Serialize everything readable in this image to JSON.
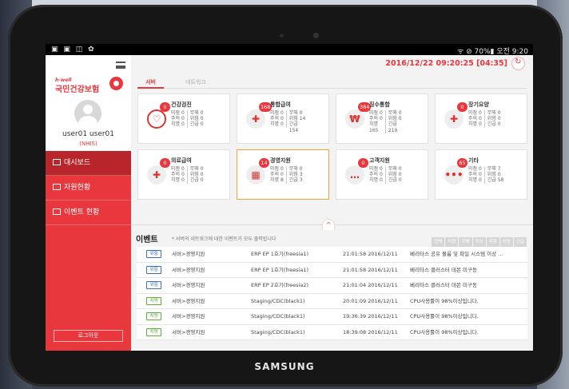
{
  "device": {
    "brand": "SAMSUNG"
  },
  "statusbar": {
    "left": "▣ ▣ ◫ ✿",
    "right": "ᯤ ⊘ 70%▮ 오전 9:20"
  },
  "sidebar": {
    "logo_small": "h-well",
    "logo_main": "국민건강보험",
    "username": "user01 user01",
    "org": "(NHIS)",
    "items": [
      {
        "label": "대시보드"
      },
      {
        "label": "자원현황"
      },
      {
        "label": "이벤트 현황"
      }
    ],
    "logout": "로그아웃"
  },
  "header": {
    "datetime": "2016/12/22 09:20:25 [04:35]"
  },
  "tabs": [
    {
      "label": "서버"
    },
    {
      "label": "네트워크"
    }
  ],
  "cards": [
    {
      "title": "건강검진",
      "badge": "0",
      "icon": "stethoscope-icon",
      "glyph": "♡",
      "c1": [
        "미점 0",
        "주의 0",
        "치명 0"
      ],
      "c2": [
        "무해 0",
        "위험 0",
        "긴급 0"
      ]
    },
    {
      "title": "통합급여",
      "badge": "168",
      "icon": "medical-document-icon",
      "glyph": "✚",
      "c1": [
        "미점 0",
        "주의 0",
        "치명 0"
      ],
      "c2": [
        "무해 0",
        "위험 14",
        "긴급",
        "154"
      ]
    },
    {
      "title": "징수통합",
      "badge": "384",
      "icon": "wallet-icon",
      "glyph": "₩",
      "c1": [
        "미점 0",
        "주의 0",
        "치명",
        "165"
      ],
      "c2": [
        "무해 0",
        "위험 0",
        "긴급",
        "219"
      ]
    },
    {
      "title": "장기요양",
      "badge": "0",
      "icon": "medical-drop-icon",
      "glyph": "✚",
      "c1": [
        "미점 0",
        "주의 0",
        "치명 0"
      ],
      "c2": [
        "무해 0",
        "위험 0",
        "긴급 0"
      ]
    },
    {
      "title": "의료급여",
      "badge": "0",
      "icon": "first-aid-icon",
      "glyph": "✚",
      "c1": [
        "미점 0",
        "주의 0",
        "치명 0"
      ],
      "c2": [
        "무해 0",
        "위험 0",
        "긴급 0"
      ]
    },
    {
      "title": "경영지원",
      "badge": "14",
      "icon": "building-icon",
      "glyph": "▦",
      "c1": [
        "미점 0",
        "주의 0",
        "치명 8"
      ],
      "c2": [
        "무해 0",
        "위험 3",
        "긴급 3"
      ]
    },
    {
      "title": "고객지원",
      "badge": "0",
      "icon": "chat-icon",
      "glyph": "…",
      "c1": [
        "미점 0",
        "주의 0",
        "치명 0"
      ],
      "c2": [
        "무해 0",
        "위험 0",
        "긴급 0"
      ]
    },
    {
      "title": "기타",
      "badge": "65",
      "icon": "more-icon",
      "glyph": "•••",
      "c1": [
        "미점 0",
        "주의 0",
        "치명 0"
      ],
      "c2": [
        "무해 7",
        "위험 0",
        "긴급 58"
      ]
    }
  ],
  "events": {
    "title": "이벤트",
    "subtitle": "* 서버의 네트워크에 대한 이벤트가 모두 출력됩니다",
    "filters": [
      "전체",
      "미점",
      "무해",
      "주의",
      "위험",
      "치명",
      "긴급"
    ],
    "rows": [
      {
        "level": "위험",
        "level_color": "#3a6fc9",
        "path": "서버>경영지원",
        "host": "ERP EP 1호기(freesia1)",
        "time": "21:01:58 2016/12/11",
        "msg": "베리타스 공유 볼륨 및 파일 시스템 이상 ..."
      },
      {
        "level": "위험",
        "level_color": "#3a6fc9",
        "path": "서버>경영지원",
        "host": "ERP EP 1호기(freesia1)",
        "time": "21:01:58 2016/12/11",
        "msg": "베리타스 클러스터 데몬 미구동"
      },
      {
        "level": "위험",
        "level_color": "#3a6fc9",
        "path": "서버>경영지원",
        "host": "ERP EP 2호기(freesia2)",
        "time": "21:01:04 2016/12/11",
        "msg": "베리타스 클러스터 데몬 미구동"
      },
      {
        "level": "치명",
        "level_color": "#5aae33",
        "path": "서버>경영지원",
        "host": "Staging/CDC(black1)",
        "time": "20:01:09 2016/12/11",
        "msg": "CPU사용률이 98%이상입니다."
      },
      {
        "level": "치명",
        "level_color": "#5aae33",
        "path": "서버>경영지원",
        "host": "Staging/CDC(black1)",
        "time": "19:36:39 2016/12/11",
        "msg": "CPU사용률이 98%이상입니다."
      },
      {
        "level": "치명",
        "level_color": "#5aae33",
        "path": "서버>경영지원",
        "host": "Staging/CDC(black1)",
        "time": "18:39:08 2016/12/11",
        "msg": "CPU사용률이 98%이상입니다."
      }
    ]
  },
  "colors": {
    "accent": "#e8373d",
    "sidebar_active": "#b8262b",
    "selected_card_border": "#f2a33c"
  }
}
